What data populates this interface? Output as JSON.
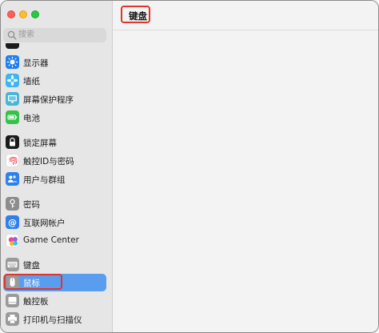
{
  "window": {
    "traffic_colors": {
      "close": "#fe5f57",
      "minimize": "#febc2e",
      "zoom": "#28c840"
    }
  },
  "search": {
    "placeholder": "搜索"
  },
  "sidebar": {
    "items": [
      {
        "label": "显示器",
        "icon": "display-icon"
      },
      {
        "label": "墙纸",
        "icon": "wallpaper-icon"
      },
      {
        "label": "屏幕保护程序",
        "icon": "screensaver-icon"
      },
      {
        "label": "电池",
        "icon": "battery-icon"
      },
      {
        "label": "锁定屏幕",
        "icon": "lock-icon"
      },
      {
        "label": "触控ID与密码",
        "icon": "fingerprint-icon"
      },
      {
        "label": "用户与群组",
        "icon": "users-icon"
      },
      {
        "label": "密码",
        "icon": "key-icon"
      },
      {
        "label": "互联网帐户",
        "icon": "at-icon"
      },
      {
        "label": "Game Center",
        "icon": "game-center-icon"
      },
      {
        "label": "键盘",
        "icon": "keyboard-icon"
      },
      {
        "label": "鼠标",
        "icon": "mouse-icon"
      },
      {
        "label": "触控板",
        "icon": "trackpad-icon"
      },
      {
        "label": "打印机与扫描仪",
        "icon": "printer-icon"
      }
    ],
    "selected": "鼠标",
    "selection_color": "#5a9dee"
  },
  "content": {
    "title": "键盘"
  },
  "annotation_color": "#e0342c"
}
